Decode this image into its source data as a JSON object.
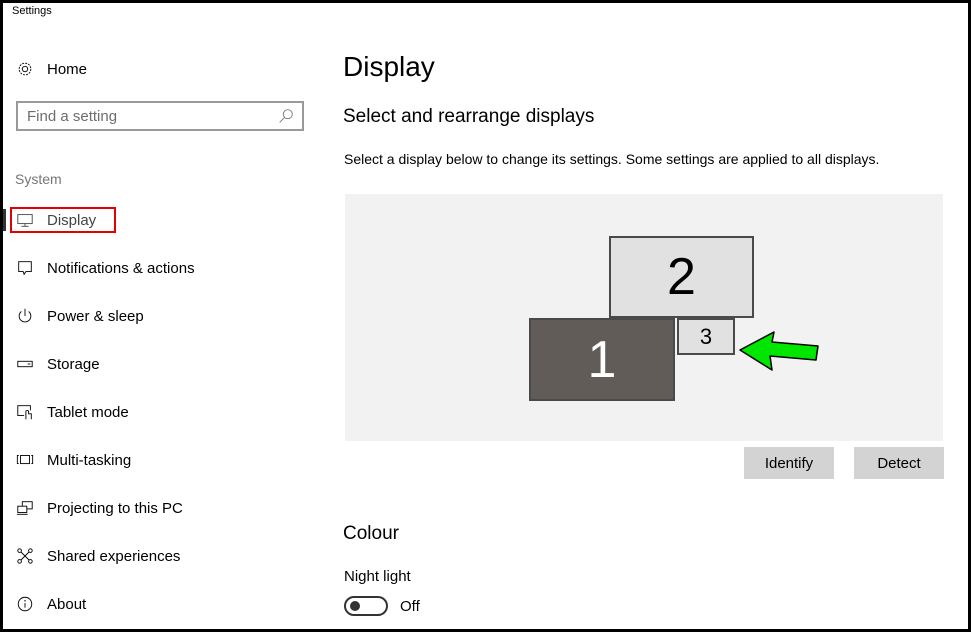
{
  "window": {
    "title": "Settings"
  },
  "sidebar": {
    "home_label": "Home",
    "search": {
      "placeholder": "Find a setting",
      "value": ""
    },
    "section_label": "System",
    "items": [
      {
        "label": "Display",
        "icon": "monitor-icon",
        "active": true
      },
      {
        "label": "Notifications & actions",
        "icon": "notification-icon"
      },
      {
        "label": "Power & sleep",
        "icon": "power-icon"
      },
      {
        "label": "Storage",
        "icon": "storage-icon"
      },
      {
        "label": "Tablet mode",
        "icon": "tablet-mode-icon"
      },
      {
        "label": "Multi-tasking",
        "icon": "multitasking-icon"
      },
      {
        "label": "Projecting to this PC",
        "icon": "projecting-icon"
      },
      {
        "label": "Shared experiences",
        "icon": "shared-experiences-icon"
      },
      {
        "label": "About",
        "icon": "info-icon"
      }
    ]
  },
  "main": {
    "title": "Display",
    "arrange": {
      "heading": "Select and rearrange displays",
      "description": "Select a display below to change its settings. Some settings are applied to all displays.",
      "monitors": [
        {
          "label": "1",
          "selected": true
        },
        {
          "label": "2",
          "selected": false
        },
        {
          "label": "3",
          "selected": false
        }
      ],
      "identify_label": "Identify",
      "detect_label": "Detect"
    },
    "colour": {
      "heading": "Colour",
      "night_light_label": "Night light",
      "night_light_state": "Off"
    }
  },
  "colors": {
    "highlight_box": "#e30000",
    "annotation_arrow": "#00e600",
    "selected_monitor": "#625c58",
    "unselected_monitor": "#e1e1e1",
    "button_bg": "#d3d3d3"
  }
}
